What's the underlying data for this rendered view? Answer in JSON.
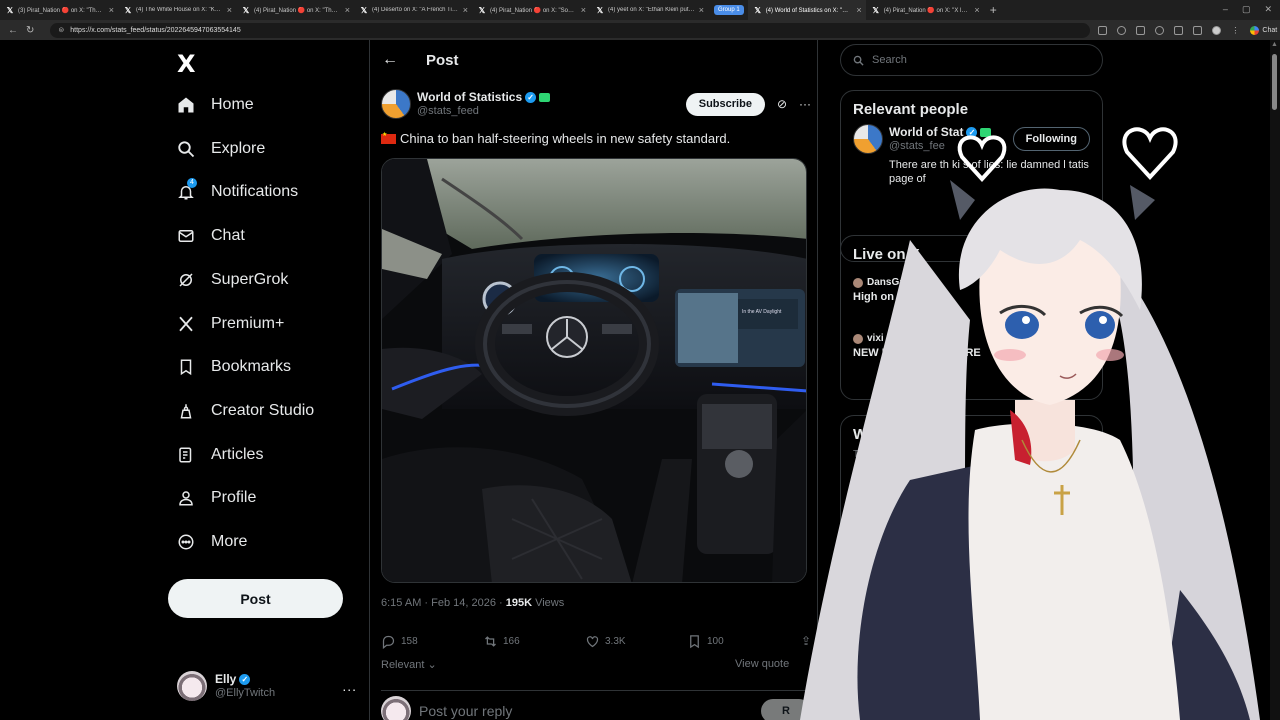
{
  "browser": {
    "tabs": [
      {
        "title": "(3) Pirat_Nation 🔴 on X: \"The Eu",
        "active": false
      },
      {
        "title": "(4) The White House on X: \"Keep",
        "active": false
      },
      {
        "title": "(4) Pirat_Nation 🔴 on X: \"The Lo",
        "active": false
      },
      {
        "title": "(4) Deserto on X: \"A French TikTo",
        "active": false
      },
      {
        "title": "(4) Pirat_Nation 🔴 on X: \"Sony h",
        "active": false
      },
      {
        "title": "(4) yeet on X: \"Ethan Klein put up",
        "active": false
      },
      {
        "title": "(4) World of Statistics on X: \"🇨🇳 Ch",
        "active": true
      },
      {
        "title": "(4) Pirat_Nation 🔴 on X: \"X laun",
        "active": false
      }
    ],
    "group_label": "Group 1",
    "url": "https://x.com/stats_feed/status/2022645947063554145",
    "chat_label": "Chat"
  },
  "sidebar": {
    "logo": "X",
    "items": [
      {
        "label": "Home",
        "icon": "home-icon"
      },
      {
        "label": "Explore",
        "icon": "search-icon"
      },
      {
        "label": "Notifications",
        "icon": "bell-icon",
        "badge": "4"
      },
      {
        "label": "Chat",
        "icon": "mail-icon"
      },
      {
        "label": "SuperGrok",
        "icon": "grok-icon"
      },
      {
        "label": "Premium+",
        "icon": "x-premium-icon"
      },
      {
        "label": "Bookmarks",
        "icon": "bookmark-icon"
      },
      {
        "label": "Creator Studio",
        "icon": "creator-studio-icon"
      },
      {
        "label": "Articles",
        "icon": "articles-icon"
      },
      {
        "label": "Profile",
        "icon": "profile-icon"
      },
      {
        "label": "More",
        "icon": "more-circle-icon"
      }
    ],
    "post_button": "Post",
    "account": {
      "name": "Elly",
      "handle": "@EllyTwitch",
      "more": "..."
    }
  },
  "main": {
    "header_title": "Post",
    "author": {
      "name": "World of Statistics",
      "handle": "@stats_feed"
    },
    "subscribe_label": "Subscribe",
    "tweet_text": "China to ban half-steering wheels in new safety standard.",
    "timestamp": "6:15 AM · Feb 14, 2026 · ",
    "views_count": "195K",
    "views_label": " Views",
    "actions": [
      {
        "icon": "reply-icon",
        "count": "158"
      },
      {
        "icon": "repost-icon",
        "count": "166"
      },
      {
        "icon": "like-icon",
        "count": "3.3K"
      },
      {
        "icon": "bookmark-icon",
        "count": "100"
      }
    ],
    "relevant_label": "Relevant",
    "view_quotes_label": "View quote",
    "reply_placeholder": "Post your reply",
    "reply_button": "R",
    "media_screen_text": "In the AV Daylight"
  },
  "right": {
    "search_placeholder": "Search",
    "relevant_people": {
      "title": "Relevant people",
      "name": "World of Stat",
      "handle": "@stats_fee",
      "following_label": "Following",
      "bio": "There are th   ki  s of lies: lie  damned l       tatis    page of"
    },
    "live": {
      "title": "Live on X",
      "items": [
        {
          "host": "DansGam",
          "title": "High on Li"
        },
        {
          "host": "vixi",
          "title": "NEW MO        PPY SI AWARE"
        }
      ]
    },
    "happening": {
      "title": "Wh      ening",
      "meta": "Tre",
      "trend": "#"
    }
  },
  "colors": {
    "accent": "#1d9bf0",
    "background": "#000000",
    "border": "#2f3336",
    "muted_text": "#71767b"
  }
}
